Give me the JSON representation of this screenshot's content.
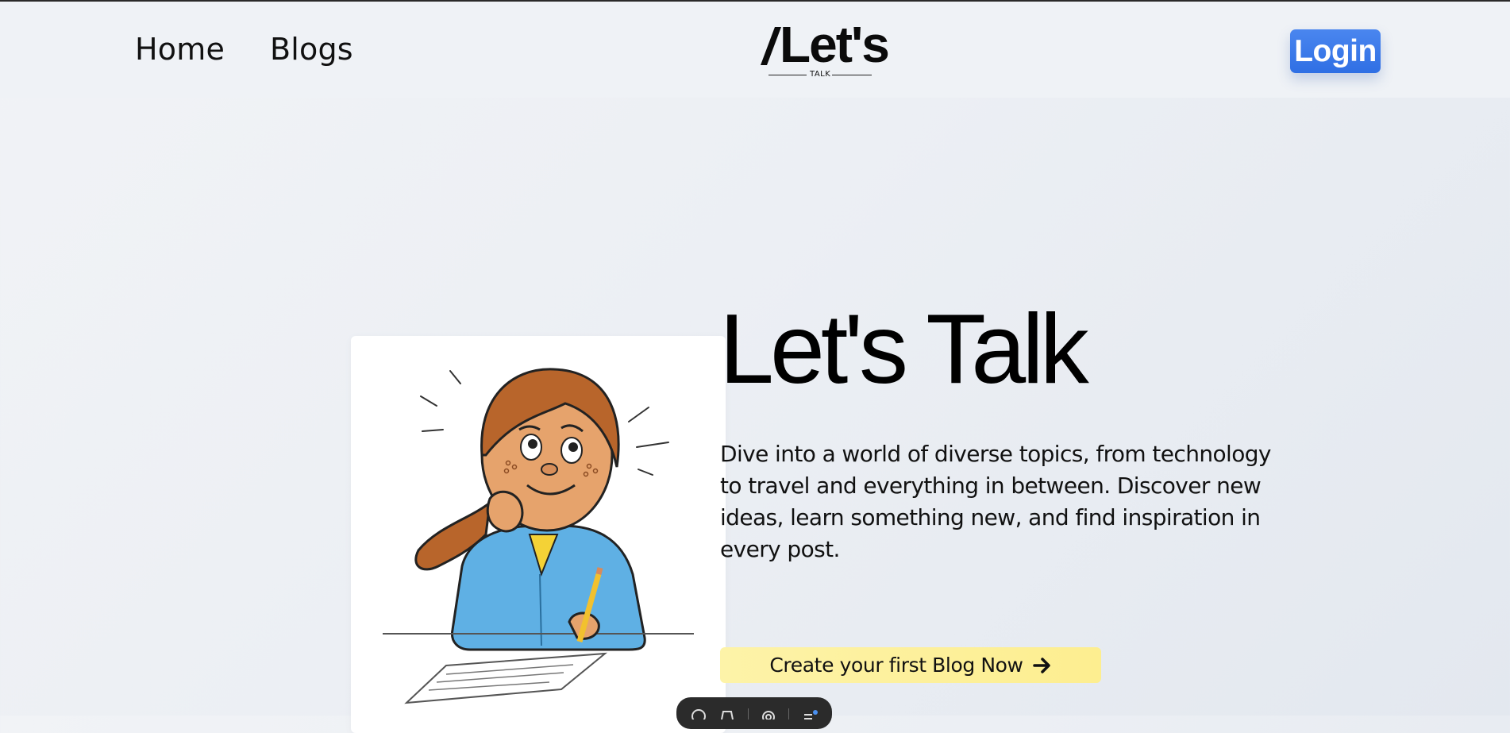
{
  "nav": {
    "home_label": "Home",
    "blogs_label": "Blogs",
    "login_label": "Login"
  },
  "logo": {
    "main_text": "Let's",
    "sub_text": "TALK"
  },
  "hero": {
    "title": "Let's Talk",
    "description": "Dive into a world of diverse topics, from technology to travel and everything in between. Discover new ideas, learn something new, and find inspiration in every post.",
    "cta_label": "Create your first Blog Now",
    "illustration_icon": "girl-thinking-writing-illustration"
  },
  "colors": {
    "login_button": "#3a7ae9",
    "cta_button": "#fdf0a0",
    "background": "#eceff4"
  }
}
